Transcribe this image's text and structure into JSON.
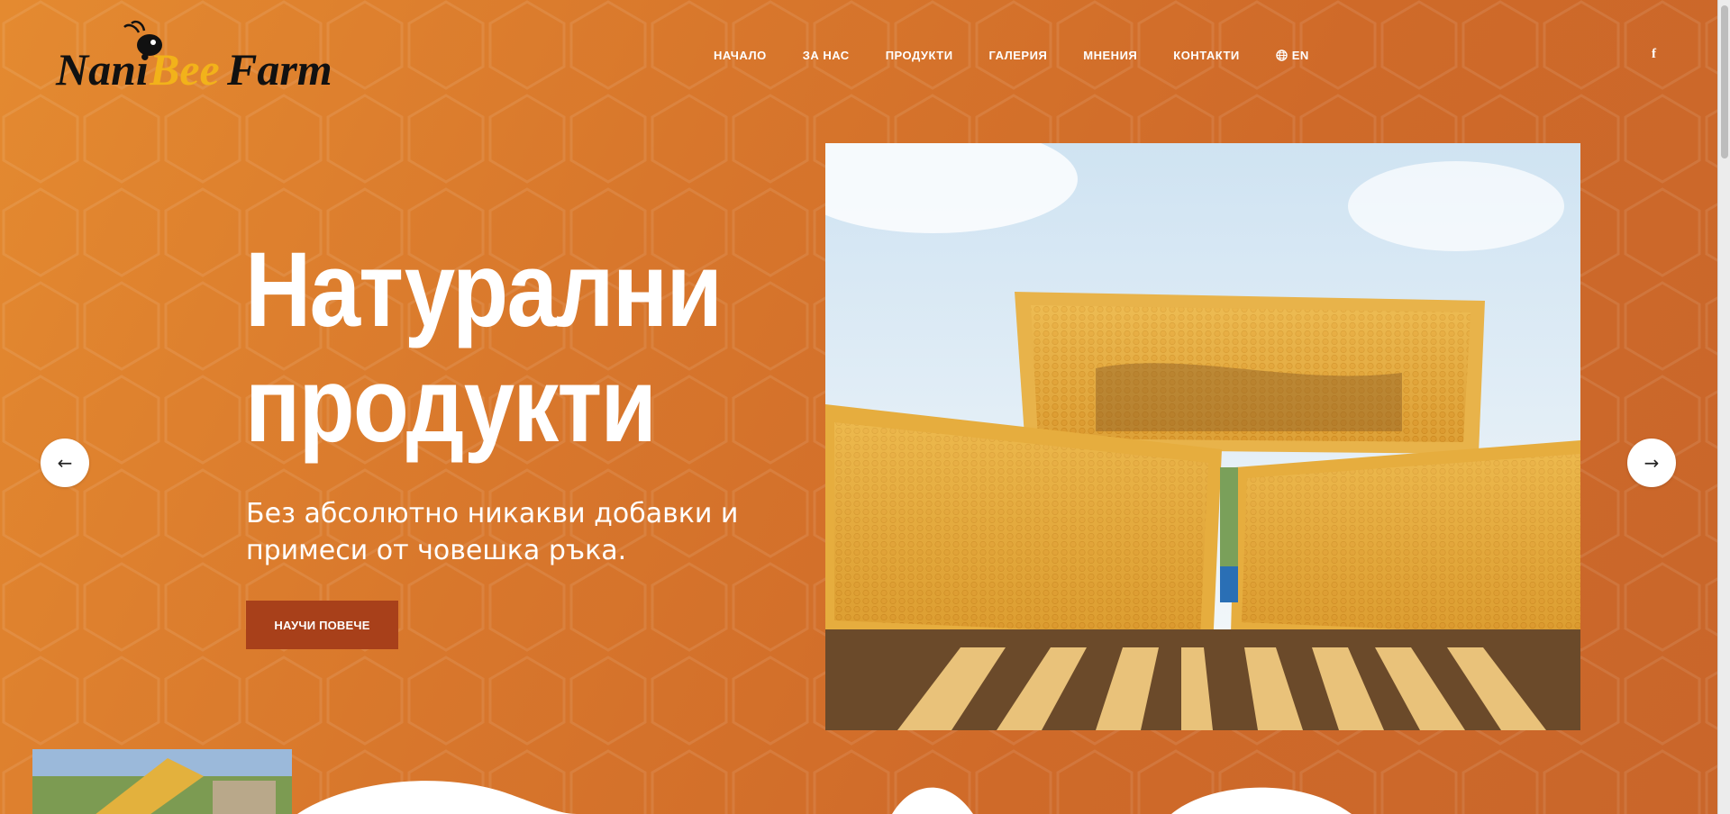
{
  "brand": {
    "logo_part1": "Nani",
    "logo_part2": "Bee",
    "logo_part3": "Farm"
  },
  "nav": {
    "items": [
      {
        "label": "НАЧАЛО"
      },
      {
        "label": "ЗА НАС"
      },
      {
        "label": "ПРОДУКТИ"
      },
      {
        "label": "ГАЛЕРИЯ"
      },
      {
        "label": "МНЕНИЯ"
      },
      {
        "label": "КОНТАКТИ"
      }
    ],
    "language": "EN",
    "language_icon": "globe-icon",
    "social_icon": "facebook-icon",
    "social_label": "f"
  },
  "slide": {
    "title_line1": "Натурални",
    "title_line2": "продукти",
    "subtitle_line1": "Без абсолютно никакви добавки и",
    "subtitle_line2": "примеси от човешка ръка.",
    "cta_label": "НАУЧИ ПОВЕЧЕ",
    "prev_icon": "arrow-left-icon",
    "prev_label": "←",
    "next_icon": "arrow-right-icon",
    "next_label": "→"
  },
  "colors": {
    "accent": "#a8401a",
    "background": "#d6752c",
    "logo_yellow": "#f2b21a",
    "text": "#ffffff"
  }
}
